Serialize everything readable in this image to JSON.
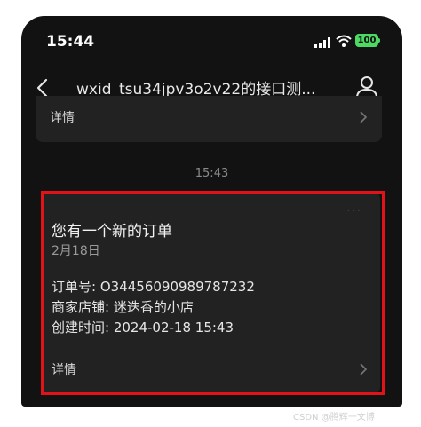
{
  "status_bar": {
    "time": "15:44",
    "battery": "100"
  },
  "nav": {
    "title": "wxid_tsu34jpv3o2v22的接口测..."
  },
  "previous_card": {
    "detail_label": "详情"
  },
  "timestamp": "15:43",
  "order_card": {
    "more": "···",
    "title": "您有一个新的订单",
    "date": "2月18日",
    "order_no_label": "订单号:",
    "order_no": "O34456090989787232",
    "shop_label": "商家店铺:",
    "shop": "迷迭香的小店",
    "created_label": "创建时间:",
    "created": "2024-02-18 15:43",
    "detail_label": "详情"
  },
  "watermark": "CSDN @腾辉一文博",
  "colors": {
    "background": "#121212",
    "card": "#222222",
    "highlight": "#e11218",
    "battery": "#4cd964"
  }
}
